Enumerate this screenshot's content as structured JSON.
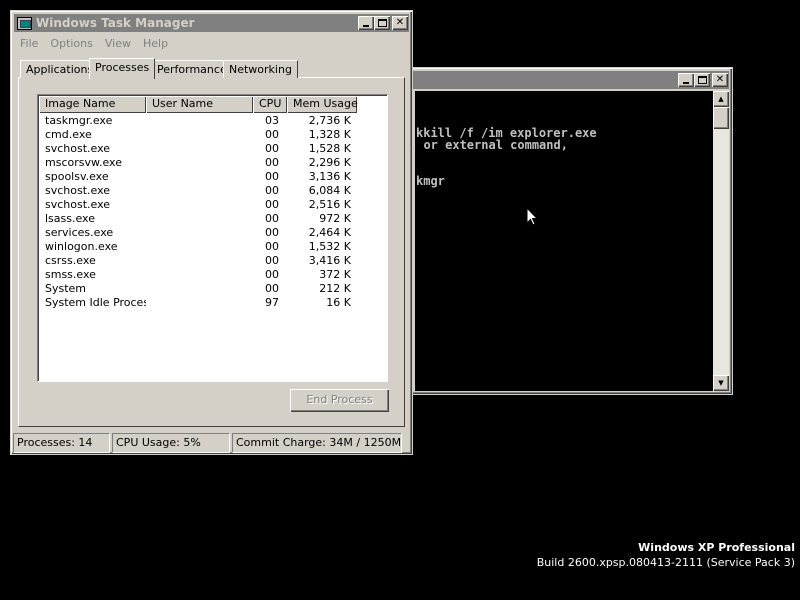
{
  "console": {
    "lines": [
      "kkill /f /im explorer.exe",
      ". or external command,",
      "",
      "kmgr"
    ]
  },
  "taskmgr": {
    "title": "Windows Task Manager",
    "menu": [
      "File",
      "Options",
      "View",
      "Help"
    ],
    "tabs": [
      "Applications",
      "Processes",
      "Performance",
      "Networking"
    ],
    "active_tab": "Processes",
    "columns": [
      "Image Name",
      "User Name",
      "CPU",
      "Mem Usage"
    ],
    "processes": [
      {
        "name": "taskmgr.exe",
        "user": "",
        "cpu": "03",
        "mem": "2,736 K"
      },
      {
        "name": "cmd.exe",
        "user": "",
        "cpu": "00",
        "mem": "1,328 K"
      },
      {
        "name": "svchost.exe",
        "user": "",
        "cpu": "00",
        "mem": "1,528 K"
      },
      {
        "name": "mscorsvw.exe",
        "user": "",
        "cpu": "00",
        "mem": "2,296 K"
      },
      {
        "name": "spoolsv.exe",
        "user": "",
        "cpu": "00",
        "mem": "3,136 K"
      },
      {
        "name": "svchost.exe",
        "user": "",
        "cpu": "00",
        "mem": "6,084 K"
      },
      {
        "name": "svchost.exe",
        "user": "",
        "cpu": "00",
        "mem": "2,516 K"
      },
      {
        "name": "lsass.exe",
        "user": "",
        "cpu": "00",
        "mem": "972 K"
      },
      {
        "name": "services.exe",
        "user": "",
        "cpu": "00",
        "mem": "2,464 K"
      },
      {
        "name": "winlogon.exe",
        "user": "",
        "cpu": "00",
        "mem": "1,532 K"
      },
      {
        "name": "csrss.exe",
        "user": "",
        "cpu": "00",
        "mem": "3,416 K"
      },
      {
        "name": "smss.exe",
        "user": "",
        "cpu": "00",
        "mem": "372 K"
      },
      {
        "name": "System",
        "user": "",
        "cpu": "00",
        "mem": "212 K"
      },
      {
        "name": "System Idle Process",
        "user": "",
        "cpu": "97",
        "mem": "16 K"
      }
    ],
    "end_process_label": "End Process",
    "status": {
      "processes": "Processes: 14",
      "cpu": "CPU Usage: 5%",
      "commit": "Commit Charge: 34M / 1250M"
    }
  },
  "desktop": {
    "os_name": "Windows XP Professional",
    "build": "Build 2600.xpsp.080413-2111 (Service Pack 3)"
  },
  "colors": {
    "desktop": "#000000",
    "window_face": "#d4d0c8",
    "inactive_title": "#808080",
    "console_text": "#c0c0c0"
  }
}
